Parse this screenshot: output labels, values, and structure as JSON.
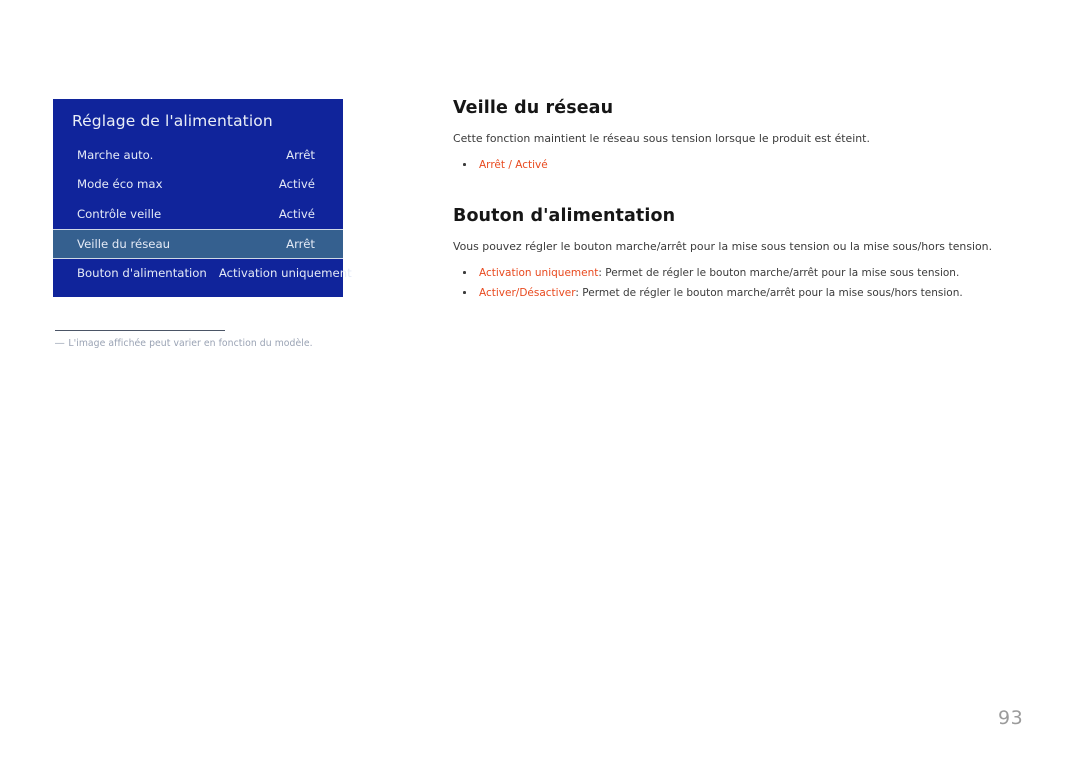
{
  "osd_menu": {
    "title": "Réglage de l'alimentation",
    "rows": [
      {
        "label": "Marche auto.",
        "value": "Arrêt",
        "highlighted": false,
        "wide": false
      },
      {
        "label": "Mode éco max",
        "value": "Activé",
        "highlighted": false,
        "wide": false
      },
      {
        "label": "Contrôle veille",
        "value": "Activé",
        "highlighted": false,
        "wide": false
      },
      {
        "label": "Veille du réseau",
        "value": "Arrêt",
        "highlighted": true,
        "wide": false
      },
      {
        "label": "Bouton d'alimentation",
        "value": "Activation uniquement",
        "highlighted": false,
        "wide": true
      }
    ],
    "colors": {
      "panel_background": "#10249b",
      "highlight_background": "#35608f",
      "highlight_border": "#cfd8e6",
      "text": "#e4eaf6"
    }
  },
  "footnote": {
    "dash": "―",
    "text": "L'image affichée peut varier en fonction du modèle."
  },
  "content": {
    "sections": [
      {
        "heading": "Veille du réseau",
        "paragraph": "Cette fonction maintient le réseau sous tension lorsque le produit est éteint.",
        "bullets": [
          {
            "option": "Arrêt / Activé",
            "description": ""
          }
        ]
      },
      {
        "heading": "Bouton d'alimentation",
        "paragraph": "Vous pouvez régler le bouton marche/arrêt pour la mise sous tension ou la mise sous/hors tension.",
        "bullets": [
          {
            "option": "Activation uniquement",
            "description": ": Permet de régler le bouton marche/arrêt pour la mise sous tension."
          },
          {
            "option": "Activer/Désactiver",
            "description": ": Permet de régler le bouton marche/arrêt pour la mise sous/hors tension."
          }
        ]
      }
    ],
    "accent_color": "#e8491e"
  },
  "page_number": "93"
}
